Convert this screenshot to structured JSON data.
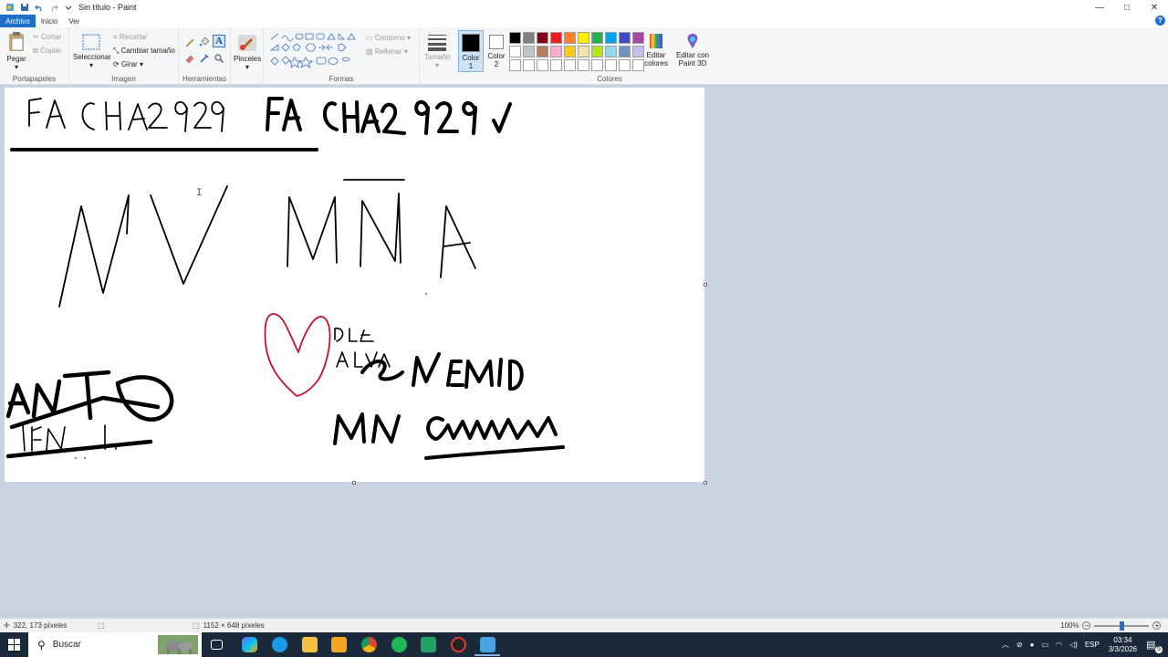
{
  "window": {
    "title": "Sin título - Paint",
    "controls": {
      "minimize": "—",
      "maximize": "□",
      "close": "✕"
    }
  },
  "tabs": [
    "Archivo",
    "Inicio",
    "Ver"
  ],
  "ribbon": {
    "portapapeles": {
      "label": "Portapapeles",
      "paste": "Pegar",
      "cut": "Cortar",
      "copy": "Copiar"
    },
    "imagen": {
      "label": "Imagen",
      "select": "Seleccionar",
      "crop": "Recortar",
      "resize": "Cambiar tamaño",
      "rotate": "Girar"
    },
    "herramientas": {
      "label": "Herramientas"
    },
    "pinceles": {
      "label": "Pinceles"
    },
    "formas": {
      "label": "Formas",
      "outline": "Contorno",
      "fill": "Rellenar"
    },
    "tamano": {
      "label": "Tamaño"
    },
    "color1": {
      "label": "Color",
      "num": "1"
    },
    "color2": {
      "label": "Color",
      "num": "2"
    },
    "colores": {
      "label": "Colores",
      "edit_line1": "Editar",
      "edit_line2": "colores"
    },
    "paint3d": {
      "line1": "Editar con",
      "line2": "Paint 3D"
    }
  },
  "palette": [
    "#000000",
    "#7f7f7f",
    "#880015",
    "#ed1c24",
    "#ff7f27",
    "#fff200",
    "#22b14c",
    "#00a2e8",
    "#3f48cc",
    "#a349a4",
    "#ffffff",
    "#c3c3c3",
    "#b97a57",
    "#ffaec9",
    "#ffc90e",
    "#efe4b0",
    "#b5e61d",
    "#99d9ea",
    "#7092be",
    "#c8bfe7",
    "#ffffff",
    "#ffffff",
    "#ffffff",
    "#ffffff",
    "#ffffff",
    "#ffffff",
    "#ffffff",
    "#ffffff",
    "#ffffff",
    "#ffffff"
  ],
  "colors": {
    "accent": "#1e6fc7",
    "color1": "#000000",
    "color2": "#ffffff",
    "heart": "#c8102e"
  },
  "status": {
    "cursor_pos": "322, 173 píxeles",
    "canvas_size": "1152 × 648 píxeles",
    "zoom": "100%"
  },
  "taskbar": {
    "search_placeholder": "Buscar",
    "lang": "ESP",
    "time": "03:34",
    "date": "3/3/2026",
    "notif_count": "5"
  }
}
